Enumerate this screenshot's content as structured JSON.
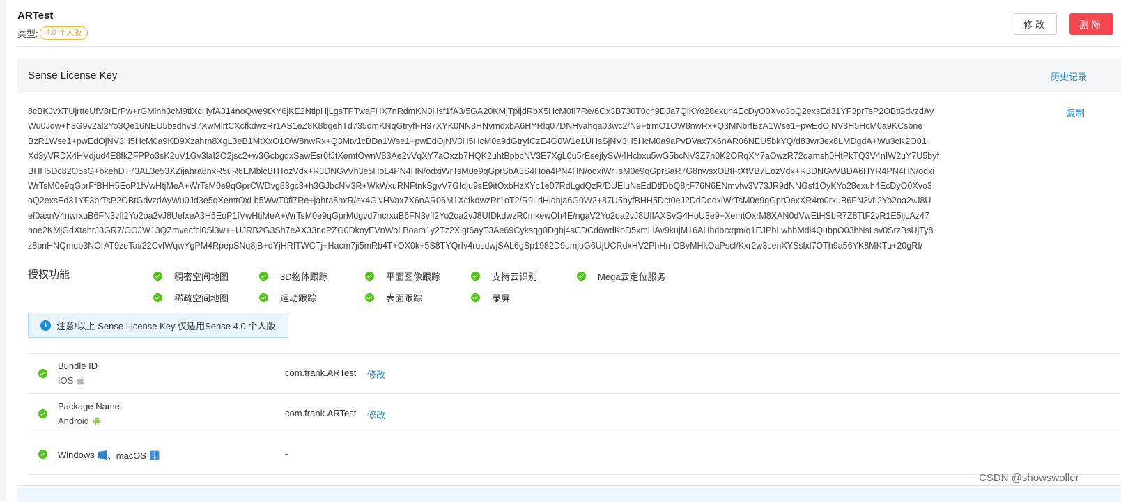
{
  "app": {
    "title": "ARTest",
    "type_label": "类型:",
    "type_badge": "4.0 个人版"
  },
  "actions": {
    "edit": "修改",
    "delete": "删除"
  },
  "license": {
    "section_title": "Sense License Key",
    "history_link": "历史记录",
    "copy_link": "复制",
    "key_lines": [
      "8cBKJvXTUjrtteUfV8rErPw+rGMlnh3cM9tiXcHyfA314noQwe9tXY6jKE2NtipHjLgsTPTwaFHX7nRdmKN0Hsf1fA3/5GA20KMjTpijdRbX5HcM0fI7Re/6Ox3B730T0ch9DJa7QiKYo28exuh4EcDyO0Xvo3oQ2exsEd31YF3prTsP2OBtGdvzdAy",
      "Wu0Jdw+h3G9v2al2Yo3Qe16NEU5bsdhvB7XwMlrtCXcfkdwzRr1AS1eZ8K8bgehTd735dmKNqGtryfFH37XYK0NN8HNvmdxbA6HYRlq07DNHvahqa03wc2/N9FtrmO1OW8nwRx+Q3MNbrfBzA1Wse1+pwEdOjNV3H5HcM0a9KCsbne",
      "BzR1Wse1+pwEdOjNV3H5HcM0a9KD9Xzahrn8XgL3eB1MtXxO1OW8nwRx+Q3Mtv1cBDa1Wse1+pwEdOjNV3H5HcM0a9dGtryfCzE4G0W1e1UHsSjNV3H5HcM0a9aPvDVax7X6nAR06NEU5bkYQ/d83wr3ex8LMDgdA+Wu3cK2O01",
      "Xd3yVRDX4HVdjud4E8fkZFPPo3sK2uV1Gv3laI2O2jsc2+w3GcbgdxSawEsr0fJtXemtOwnV83Ae2vVqXY7aOxzb7HQK2uhtBpbcNV3E7XgL0u5rEsejlySW4Hcbxu5wG5bcNV3Z7n0K2ORqXY7aOwzR72oamsh0HtPkTQ3V4nIW2uY7U5byf",
      "BHH5Dc82O5sG+bkehDT73AL3e53XZijahra8nxR5uR6EMblcBHTozVdx+R3DNGvVh3e5HoL4PN4HN/odxiWrTsM0e9qGprSbA3S4Hoa4PN4HN/odxiWrTsM0e9qGprSaR7G8nwsxOBtFtXtVB7EozVdx+R3DNGvVBDA6HYR4PN4HN/odxi",
      "WrTsM0e9qGprFfBHH5EoP1fVwHtjMeA+WrTsM0e9qGprCWDvg83gc3+h3GJbcNV3R+WkWxuRNFtnkSgvV7GIdju9sE9itOxbHzXYc1e07RdLgdQzR/DUEluNsEdDtfDbQ8jtF76N6ENmvfw3V73JR9dNNGsf1OyKYo28exuh4EcDyO0Xvo3",
      "oQ2exsEd31YF3prTsP2OBtGdvzdAyWu0Jd3e5qXemtOxLb5WwT0fl7Re+jahra8nxR/ex4GNHVax7X6nAR06M1XcfkdwzRr1oT2/R9LdHidhja6G0W2+87U5byfBHH5Dct0eJ2DdDodxiWrTsM0e9qGprOexXR4m0rxuB6FN3vfI2Yo2oa2vJ8U",
      "ef0axnV4nwrxuB6FN3vfl2Yo2oa2vJ8UefxeA3H5EoP1fVwHtjMeA+WrTsM0e9qGprMdgvd7ncrxuB6FN3vfl2Yo2oa2vJ8UfDkdwzR0mkewOh4E/ngaV2Yo2oa2vJ8UffAXSvG4HoU3e9+XemtOxrM8XAN0dVwEtHSbR7Z8TtF2vR1E5ijcAz47",
      "noe2KMjGdXtahrJ3GR7/OOJW13QZmvecfcl0Sl3w++UJRB2G3Sh7eAX33ndPZG0DkoyEVnWoLBoam1y2Tz2Xlgt6ayT3Ae69Cyksqg0Dgbj4sCDCd6wdKoD5xmLiAv9kujM16AHhdbrxqm/q1EJPbLwhhMdi4QubpO03hNsLsv0SrzBsUjTy8",
      "z8pnHNQmub3NOrAT9zeTai/22CvfWqwYgPM4RpepSNq8jB+dYjHRfTWCTj+Hacm7ji5mRb4T+OX0k+5S8TYQrfv4rusdwjSAL6gSp1982D9umjoG6UjUCRdxHV2PhHmOBvMHkOaPscl/Kxr2w3cenXYSslxl7OTh9a56YK8MKTu+20gRI/"
    ]
  },
  "features": {
    "label": "授权功能",
    "row1": [
      "稠密空间地图",
      "3D物体跟踪",
      "平面图像跟踪",
      "支持云识别",
      "Mega云定位服务"
    ],
    "row2": [
      "稀疏空间地图",
      "运动跟踪",
      "表面跟踪",
      "录屏"
    ]
  },
  "notice": {
    "icon": "i",
    "text": "注意!以上 Sense License Key 仅适用Sense 4.0 个人版"
  },
  "platforms": [
    {
      "name": "Bundle ID",
      "os": "IOS",
      "os_icon": "apple-icon",
      "value": "com.frank.ARTest",
      "action": "修改"
    },
    {
      "name": "Package Name",
      "os": "Android",
      "os_icon": "android-icon",
      "value": "com.frank.ARTest",
      "action": "修改"
    },
    {
      "name": "Windows",
      "sep": "、macOS",
      "value": "-"
    }
  ],
  "watermark": "CSDN @showswoller",
  "colors": {
    "primary": "#1e8bdc",
    "danger": "#f5484e",
    "success": "#52c41a",
    "badge": "#f5b82a"
  }
}
